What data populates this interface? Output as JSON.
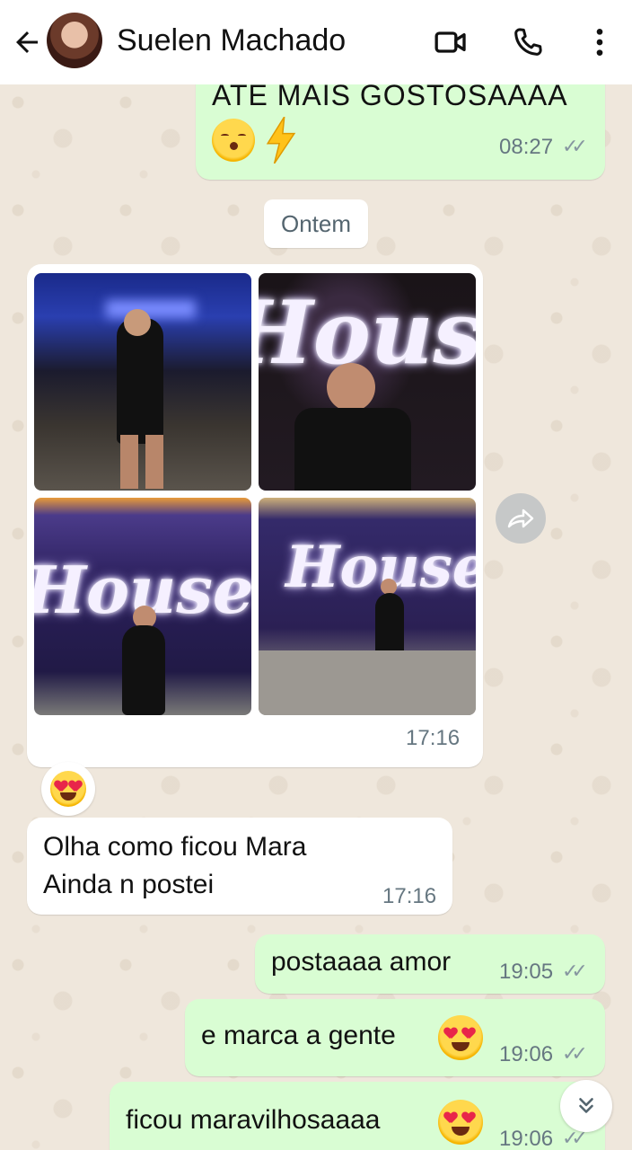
{
  "header": {
    "contact_name": "Suelen Machado",
    "icons": [
      "back-arrow-icon",
      "video-call-icon",
      "voice-call-icon",
      "more-options-icon"
    ]
  },
  "messages": {
    "top_out": {
      "text": "ATE MAIS GOSTOSAAAA",
      "time": "08:27",
      "status": "read"
    },
    "date_separator": "Ontem",
    "album": {
      "photo_count": 4,
      "time": "17:16",
      "neon_text": "House"
    },
    "incoming_text": {
      "line1": "Olha como ficou Mara",
      "line2": "Ainda n postei",
      "time": "17:16"
    },
    "out1": {
      "text": "postaaaa amor",
      "time": "19:05"
    },
    "out2": {
      "text": "e marca a gente",
      "time": "19:06"
    },
    "out3": {
      "text": "ficou maravilhosaaaa",
      "time": "19:06"
    }
  },
  "colors": {
    "outgoing_bubble": "#d9fdd3",
    "incoming_bubble": "#ffffff",
    "chat_background": "#efe7dc",
    "time_text": "#667781"
  }
}
